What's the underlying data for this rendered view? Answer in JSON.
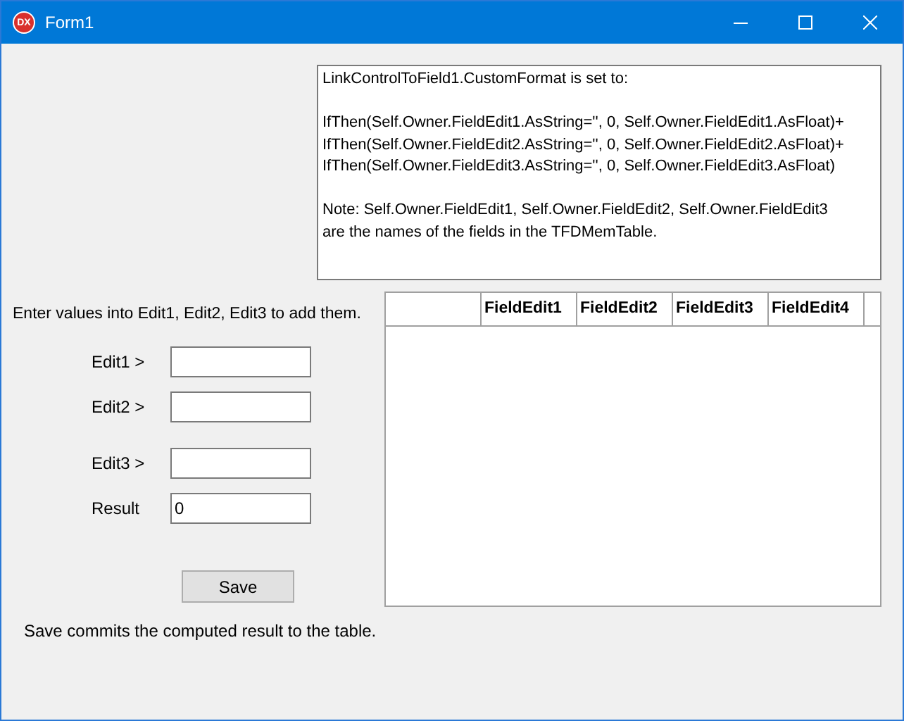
{
  "window": {
    "title": "Form1",
    "app_icon_text": "DX"
  },
  "memo": {
    "paragraphs": [
      "LinkControlToField1.CustomFormat is set to:",
      "IfThen(Self.Owner.FieldEdit1.AsString='', 0, Self.Owner.FieldEdit1.AsFloat)+\nIfThen(Self.Owner.FieldEdit2.AsString='', 0, Self.Owner.FieldEdit2.AsFloat)+\nIfThen(Self.Owner.FieldEdit3.AsString='', 0, Self.Owner.FieldEdit3.AsFloat)",
      "Note: Self.Owner.FieldEdit1, Self.Owner.FieldEdit2, Self.Owner.FieldEdit3\nare the names of the fields in the TFDMemTable."
    ]
  },
  "instruction": "Enter values into Edit1, Edit2, Edit3 to add them.",
  "fields": [
    {
      "label": "Edit1 >"
    },
    {
      "label": "Edit2 >"
    },
    {
      "label": "Edit3 >"
    },
    {
      "label": "Result",
      "value": "0"
    }
  ],
  "save_button": "Save",
  "footer_note": "Save commits the computed result to the table.",
  "table": {
    "columns": [
      "FieldEdit1",
      "FieldEdit2",
      "FieldEdit3",
      "FieldEdit4"
    ]
  }
}
